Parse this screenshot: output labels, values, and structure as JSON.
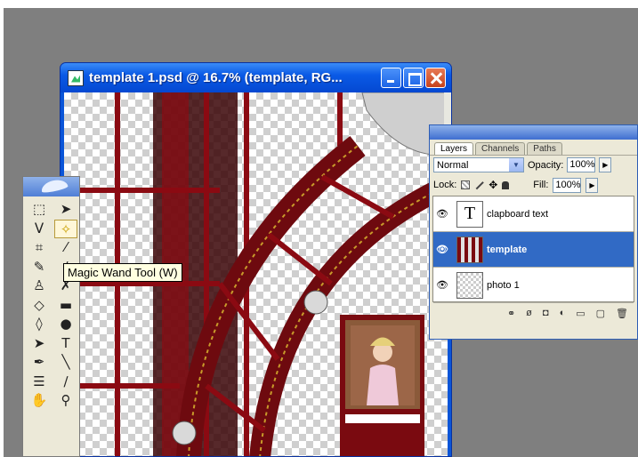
{
  "document": {
    "title": "template 1.psd @ 16.7% (template, RG...",
    "controls": [
      "minimize",
      "maximize",
      "close"
    ]
  },
  "toolbox": {
    "tools": [
      {
        "name": "marquee-tool-icon",
        "glyph": "⬚"
      },
      {
        "name": "move-tool-icon",
        "glyph": "➤"
      },
      {
        "name": "lasso-tool-icon",
        "glyph": "ᐯ"
      },
      {
        "name": "magic-wand-tool-icon",
        "glyph": "✧",
        "active": true
      },
      {
        "name": "crop-tool-icon",
        "glyph": "⌗"
      },
      {
        "name": "slice-tool-icon",
        "glyph": "⁄"
      },
      {
        "name": "healing-brush-icon",
        "glyph": "✎"
      },
      {
        "name": "brush-tool-icon",
        "glyph": "∕"
      },
      {
        "name": "clone-stamp-icon",
        "glyph": "♙"
      },
      {
        "name": "history-brush-icon",
        "glyph": "✗"
      },
      {
        "name": "eraser-tool-icon",
        "glyph": "◇"
      },
      {
        "name": "gradient-tool-icon",
        "glyph": "▬"
      },
      {
        "name": "blur-tool-icon",
        "glyph": "◊"
      },
      {
        "name": "dodge-tool-icon",
        "glyph": "●"
      },
      {
        "name": "path-selection-icon",
        "glyph": "➤"
      },
      {
        "name": "type-tool-icon",
        "glyph": "T"
      },
      {
        "name": "pen-tool-icon",
        "glyph": "✒"
      },
      {
        "name": "line-tool-icon",
        "glyph": "╲"
      },
      {
        "name": "notes-tool-icon",
        "glyph": "☰"
      },
      {
        "name": "eyedropper-tool-icon",
        "glyph": "∕"
      },
      {
        "name": "hand-tool-icon",
        "glyph": "✋"
      },
      {
        "name": "zoom-tool-icon",
        "glyph": "⚲"
      }
    ],
    "tooltip": "Magic Wand Tool (W)"
  },
  "layers_panel": {
    "tabs": [
      "Layers",
      "Channels",
      "Paths"
    ],
    "blend_mode": "Normal",
    "opacity_label": "Opacity:",
    "opacity_value": "100%",
    "lock_label": "Lock:",
    "fill_label": "Fill:",
    "fill_value": "100%",
    "layers": [
      {
        "name": "clapboard text",
        "type": "text",
        "visible": true,
        "selected": false
      },
      {
        "name": "template",
        "type": "image",
        "visible": true,
        "selected": true
      },
      {
        "name": "photo 1",
        "type": "transparent",
        "visible": true,
        "selected": false
      }
    ]
  },
  "colors": {
    "workspace": "#7f7f7f",
    "titlebar": "#0a5ae6",
    "selected_layer": "#316ac5",
    "film_red": "#8b0a12"
  }
}
